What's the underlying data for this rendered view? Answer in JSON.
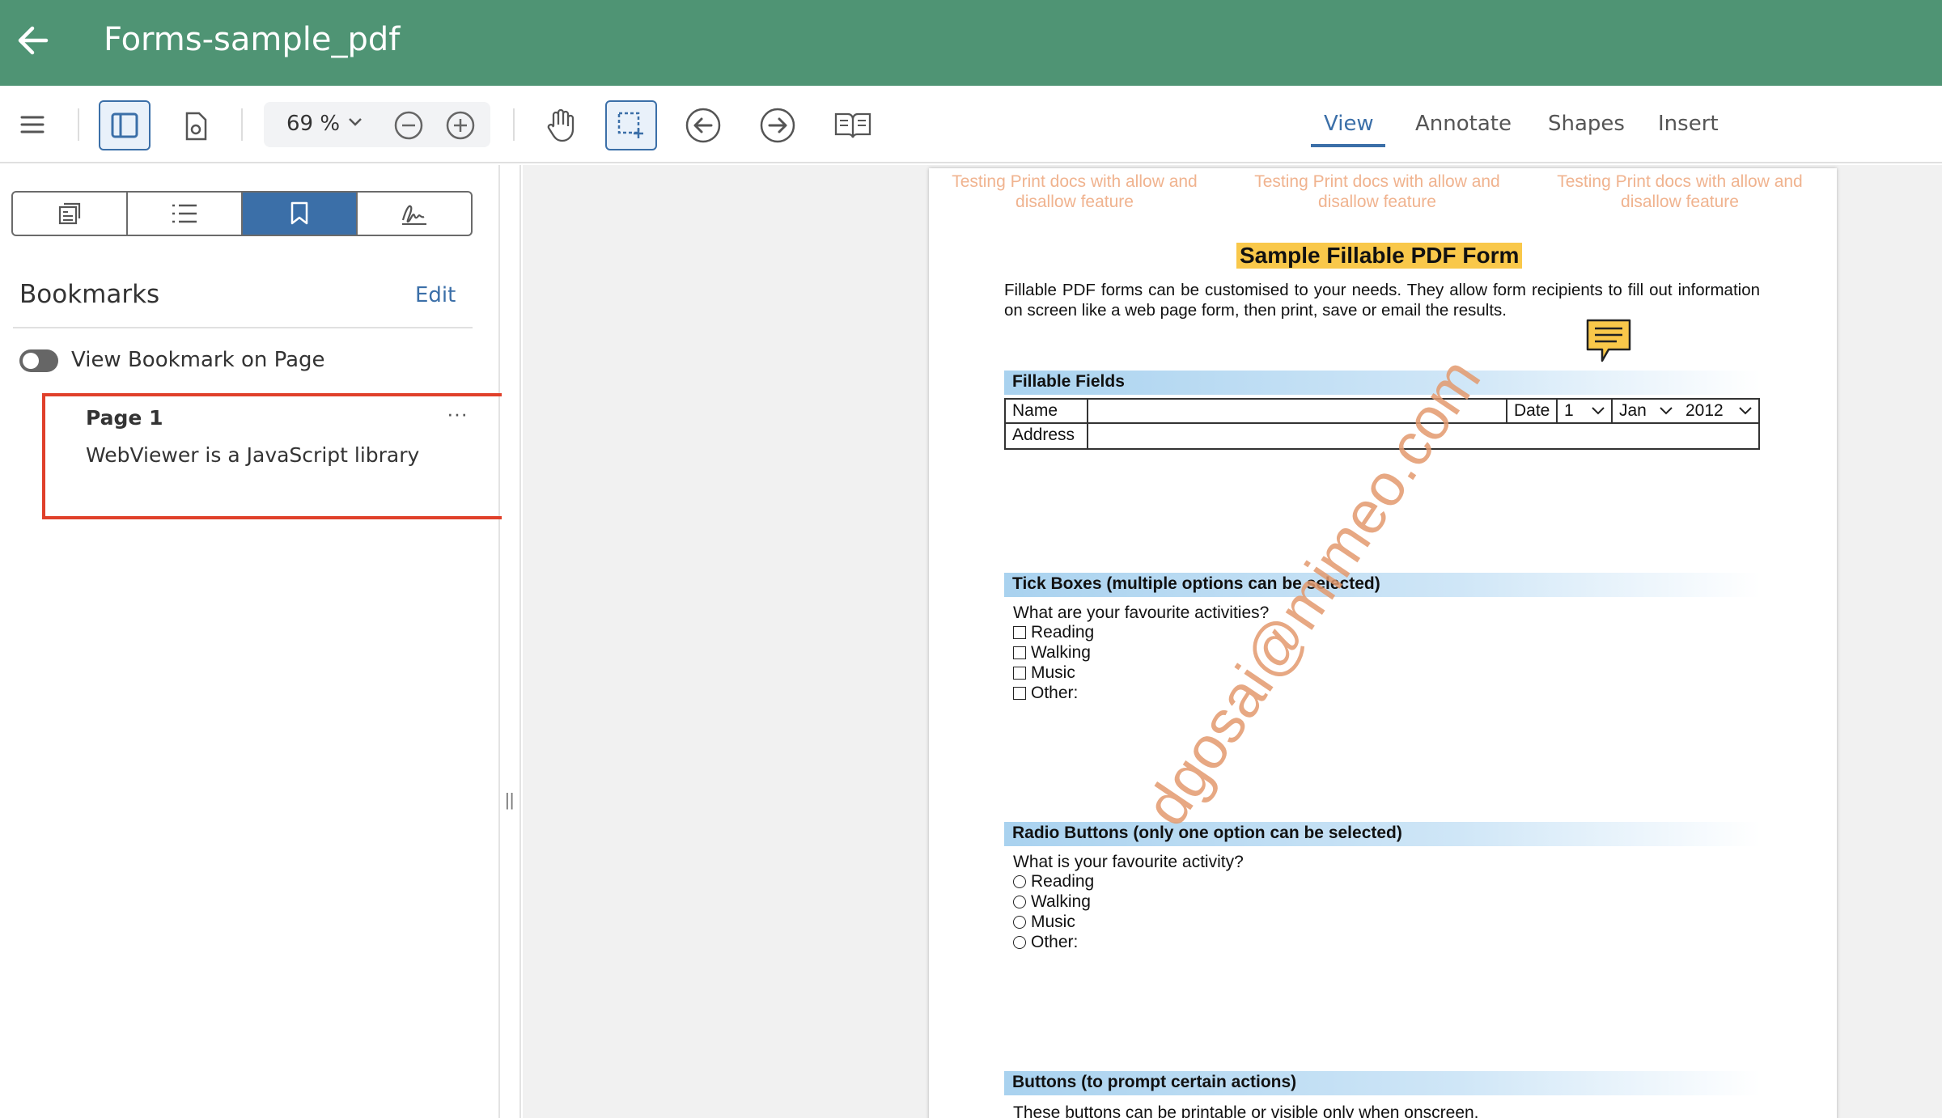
{
  "header": {
    "title": "Forms-sample_pdf",
    "back_icon": "arrow-left-icon",
    "color": "#4f9474"
  },
  "toolbar": {
    "zoom": "69",
    "zoom_unit": "%",
    "tabs": [
      {
        "label": "View",
        "active": true
      },
      {
        "label": "Annotate",
        "active": false
      },
      {
        "label": "Shapes",
        "active": false
      },
      {
        "label": "Insert",
        "active": false
      }
    ],
    "accent": "#3b6fa8"
  },
  "left_panel": {
    "heading": "Bookmarks",
    "edit_label": "Edit",
    "toggle_label": "View Bookmark on Page",
    "toggle_on": false,
    "bookmark": {
      "page": "Page 1",
      "more": "···",
      "text": "WebViewer is a JavaScript library for"
    }
  },
  "document": {
    "watermark_header": "Testing Print docs with allow and disallow feature",
    "watermark_diagonal": "dgosai@mimeo.com",
    "title": "Sample Fillable PDF Form",
    "intro": "Fillable PDF forms can be customised to your needs. They allow form recipients to fill out information on screen like a web page form, then print, save or email the results.",
    "fillable": {
      "section": "Fillable Fields",
      "name_label": "Name",
      "address_label": "Address",
      "date_label": "Date",
      "day": "1",
      "month": "Jan",
      "year": "2012"
    },
    "tick": {
      "section": "Tick Boxes (multiple options can be selected)",
      "question": "What are your favourite activities?",
      "options": [
        "Reading",
        "Walking",
        "Music",
        "Other:"
      ]
    },
    "radio": {
      "section": "Radio Buttons (only one option can be selected)",
      "question": "What is your favourite activity?",
      "options": [
        "Reading",
        "Walking",
        "Music",
        "Other:"
      ]
    },
    "buttons": {
      "section": "Buttons (to prompt certain actions)",
      "text": "These buttons can be printable or visible only when onscreen."
    }
  }
}
